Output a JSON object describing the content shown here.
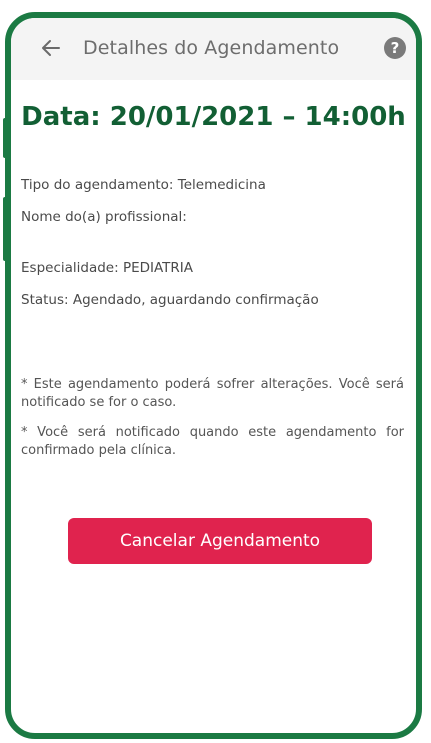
{
  "header": {
    "back_icon": "arrow-left-icon",
    "title": "Detalhes do Agendamento",
    "help_icon": "question-circle-icon"
  },
  "appointment": {
    "date_line": "Data: 20/01/2021 – 14:00h",
    "type": "Tipo do agendamento: Telemedicina",
    "professional": "Nome do(a) profissional:",
    "specialty": "Especialidade: PEDIATRIA",
    "status": "Status: Agendado, aguardando confirmação"
  },
  "notes": {
    "note1": "* Este agendamento poderá sofrer alterações. Você será notificado se for o caso.",
    "note2": "* Você será notificado quando este agendamento for confirmado pela clínica."
  },
  "actions": {
    "cancel_label": "Cancelar Agendamento"
  },
  "colors": {
    "frame": "#1b7a43",
    "date_text": "#125f34",
    "cancel_button": "#e0234e"
  }
}
